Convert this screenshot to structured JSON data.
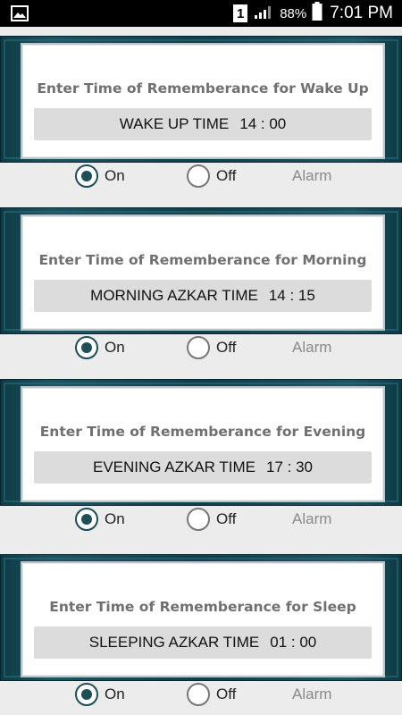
{
  "status_bar": {
    "sim_slot": "1",
    "battery": "88%",
    "time": "7:01 PM",
    "icons": [
      "gallery-icon",
      "signal-icon",
      "battery-icon"
    ]
  },
  "colors": {
    "frame": "#0f3f49",
    "radio_selected": "#1e4e56",
    "button_bg": "#dcdcdc",
    "page_bg": "#ececec"
  },
  "sections": [
    {
      "title": "Enter Time of Rememberance for Wake Up",
      "label": "WAKE UP TIME",
      "time": "14 : 00",
      "on_label": "On",
      "off_label": "Off",
      "alarm_label": "Alarm",
      "selected": "on"
    },
    {
      "title": "Enter Time of Rememberance for Morning",
      "label": "MORNING AZKAR TIME",
      "time": "14 : 15",
      "on_label": "On",
      "off_label": "Off",
      "alarm_label": "Alarm",
      "selected": "on"
    },
    {
      "title": "Enter Time of Rememberance for Evening",
      "label": "EVENING AZKAR TIME",
      "time": "17 : 30",
      "on_label": "On",
      "off_label": "Off",
      "alarm_label": "Alarm",
      "selected": "on"
    },
    {
      "title": "Enter Time of Rememberance for Sleep",
      "label": "SLEEPING AZKAR TIME",
      "time": "01 : 00",
      "on_label": "On",
      "off_label": "Off",
      "alarm_label": "Alarm",
      "selected": "on"
    }
  ]
}
